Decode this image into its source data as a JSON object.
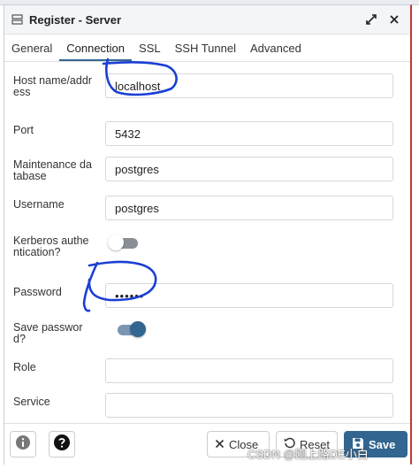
{
  "window": {
    "title": "Register - Server"
  },
  "tabs": [
    "General",
    "Connection",
    "SSL",
    "SSH Tunnel",
    "Advanced"
  ],
  "active_tab": "Connection",
  "fields": {
    "host": {
      "label": "Host name/address",
      "value": "localhost"
    },
    "port": {
      "label": "Port",
      "value": "5432"
    },
    "maintenance_db": {
      "label": "Maintenance database",
      "value": "postgres"
    },
    "username": {
      "label": "Username",
      "value": "postgres"
    },
    "kerberos": {
      "label": "Kerberos authentication?",
      "enabled": false
    },
    "password": {
      "label": "Password",
      "value": "••••••"
    },
    "save_password": {
      "label": "Save password?",
      "enabled": true
    },
    "role": {
      "label": "Role",
      "value": ""
    },
    "service": {
      "label": "Service",
      "value": ""
    }
  },
  "footer": {
    "close_label": "Close",
    "reset_label": "Reset",
    "save_label": "Save"
  },
  "watermark": "CSDN @刚上路DE小白",
  "colors": {
    "accent": "#326690",
    "annotation": "#1a3fd4"
  },
  "icons": [
    "server-icon",
    "expand-icon",
    "close-icon",
    "info-icon",
    "help-icon",
    "close-x-icon",
    "reset-icon",
    "save-icon"
  ]
}
